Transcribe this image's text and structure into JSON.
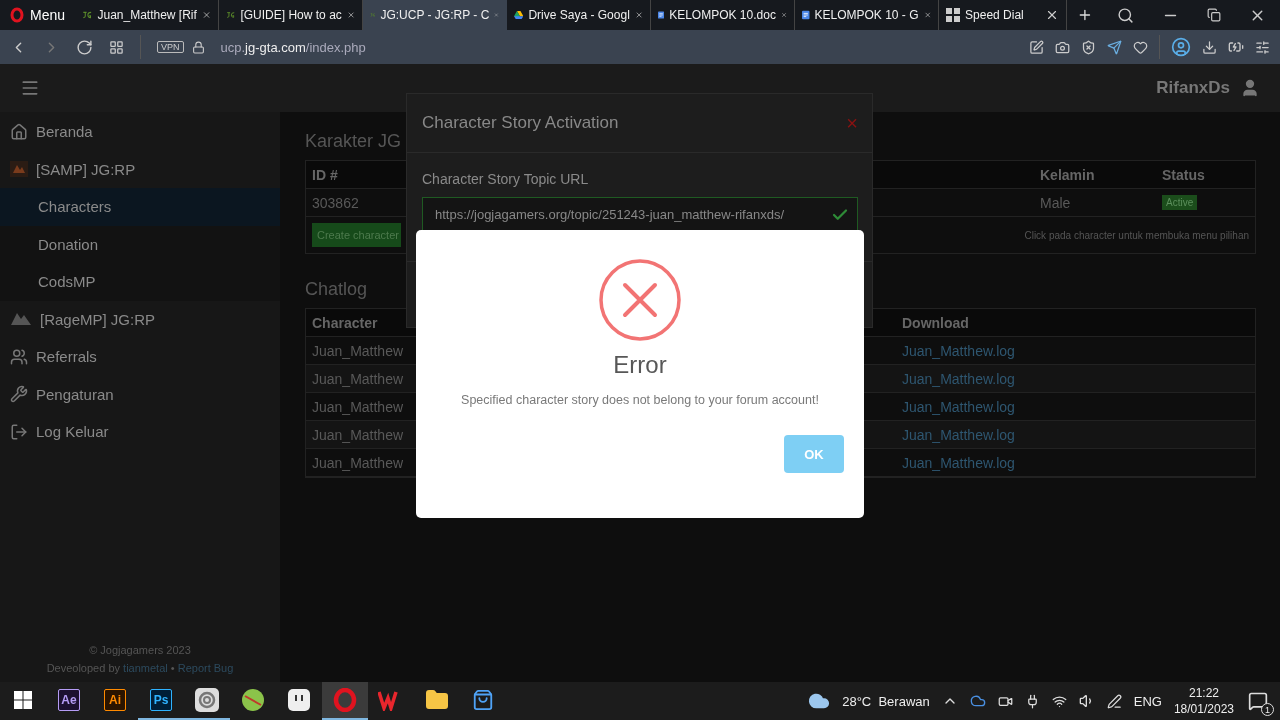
{
  "browser": {
    "menu": "Menu",
    "tabs": [
      {
        "label": "Juan_Matthew [Rif",
        "kind": "jg",
        "selected": false
      },
      {
        "label": "[GUIDE] How to ac",
        "kind": "jg",
        "selected": false
      },
      {
        "label": "JG:UCP - JG:RP - C",
        "kind": "jg",
        "selected": true
      },
      {
        "label": "Drive Saya - Googl",
        "kind": "drive",
        "selected": false
      },
      {
        "label": "KELOMPOK 10.doc",
        "kind": "docs",
        "selected": false
      },
      {
        "label": "KELOMPOK 10 - G",
        "kind": "docs",
        "selected": false
      },
      {
        "label": "Speed Dial",
        "kind": "grid",
        "selected": false
      }
    ],
    "vpn": "VPN",
    "url": {
      "sub": "ucp.",
      "domain": "jg-gta.com",
      "path": "/index.php"
    }
  },
  "navbar": {
    "user": "RifanxDs"
  },
  "sidebar": {
    "items": [
      {
        "label": "Beranda",
        "kind": "home",
        "selected": false
      },
      {
        "label": "[SAMP] JG:RP",
        "kind": "samp",
        "selected": false,
        "expanded": true,
        "children": [
          {
            "label": "Characters",
            "selected": true
          },
          {
            "label": "Donation",
            "selected": false
          },
          {
            "label": "CodsMP",
            "selected": false
          }
        ]
      },
      {
        "label": "[RageMP] JG:RP",
        "kind": "ragemp",
        "selected": false
      },
      {
        "label": "Referrals",
        "kind": "users",
        "selected": false
      },
      {
        "label": "Pengaturan",
        "kind": "wrench",
        "selected": false
      },
      {
        "label": "Log Keluar",
        "kind": "logout",
        "selected": false
      }
    ],
    "copyright": "© Jogjagamers 2023",
    "credit_prefix": "Deveoloped by",
    "credit_author": "tianmetal",
    "credit_separator": "•",
    "credit_report": "Report Bug"
  },
  "characters": {
    "title": "Karakter JG",
    "columns": [
      "ID #",
      "Kelamin",
      "Status"
    ],
    "rows": [
      {
        "id": "303862",
        "gender": "Male",
        "status": "Active"
      }
    ],
    "create_button": "Create character",
    "hint": "Click pada character untuk membuka menu pilihan"
  },
  "chatlog": {
    "title": "Chatlog",
    "columns": [
      "Character",
      "Download"
    ],
    "rows": [
      {
        "character": "Juan_Matthew",
        "file": "Juan_Matthew.log"
      },
      {
        "character": "Juan_Matthew",
        "file": "Juan_Matthew.log"
      },
      {
        "character": "Juan_Matthew",
        "file": "Juan_Matthew.log"
      },
      {
        "character": "Juan_Matthew",
        "file": "Juan_Matthew.log"
      },
      {
        "character": "Juan_Matthew",
        "file": "Juan_Matthew.log"
      }
    ]
  },
  "story_modal": {
    "title": "Character Story Activation",
    "close": "×",
    "label": "Character Story Topic URL",
    "value": "https://jogjagamers.org/topic/251243-juan_matthew-rifanxds/",
    "valid": true
  },
  "error_dialog": {
    "title": "Error",
    "message": "Specified character story does not belong to your forum account!",
    "button": "OK"
  },
  "taskbar": {
    "apps": [
      {
        "kind": "ae",
        "label": "Ae",
        "running": false,
        "selected": false
      },
      {
        "kind": "ai",
        "label": "Ai",
        "running": false,
        "selected": false
      },
      {
        "kind": "ps",
        "label": "Ps",
        "running": true,
        "selected": false
      },
      {
        "kind": "swirl",
        "running": true,
        "selected": false
      },
      {
        "kind": "lime",
        "running": false,
        "selected": false
      },
      {
        "kind": "square",
        "running": false,
        "selected": false
      },
      {
        "kind": "opera",
        "running": true,
        "selected": true
      },
      {
        "kind": "wps",
        "running": false,
        "selected": false
      },
      {
        "kind": "folder",
        "running": false,
        "selected": false
      },
      {
        "kind": "store",
        "running": false,
        "selected": false
      }
    ],
    "weather": "28°C  Berawan",
    "language": "ENG",
    "time": "21:22",
    "date": "18/01/2023",
    "notifications": "1"
  }
}
